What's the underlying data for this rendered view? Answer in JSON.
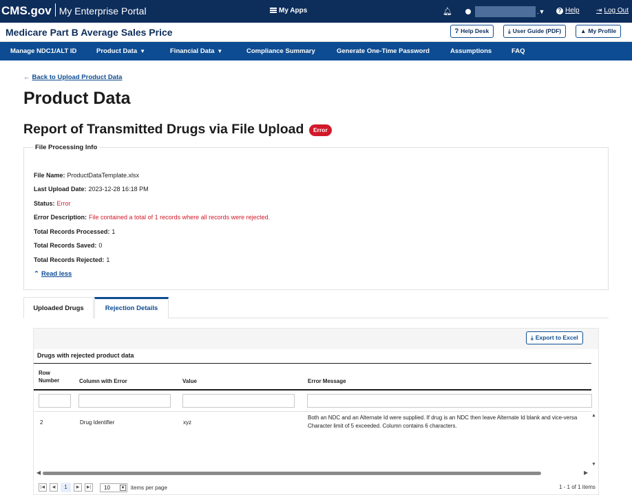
{
  "topbar": {
    "brand": "CMS.gov",
    "portal": "My Enterprise Portal",
    "my_apps": "My Apps",
    "help": "Help",
    "logout": "Log Out"
  },
  "header": {
    "app_title": "Medicare Part B Average Sales Price",
    "help_desk": "Help Desk",
    "user_guide": "User Guide (PDF)",
    "my_profile": "My Profile"
  },
  "nav": {
    "items": [
      {
        "label": "Manage NDC1/ALT ID"
      },
      {
        "label": "Product Data"
      },
      {
        "label": "Financial Data"
      },
      {
        "label": "Compliance Summary"
      },
      {
        "label": "Generate One-Time Password"
      },
      {
        "label": "Assumptions"
      },
      {
        "label": "FAQ"
      }
    ]
  },
  "page": {
    "back_link": "Back to Upload Product Data",
    "title": "Product Data",
    "subtitle": "Report of Transmitted Drugs via File Upload",
    "status_badge": "Error"
  },
  "info": {
    "legend": "File Processing Info",
    "rows": [
      {
        "label": "File Name:",
        "value": "ProductDataTemplate.xlsx"
      },
      {
        "label": "Last Upload Date:",
        "value": "2023-12-28 16:18 PM"
      },
      {
        "label": "Status:",
        "value": "Error"
      },
      {
        "label": "Error Description:",
        "value": "File contained a total of 1 records where all records were rejected."
      },
      {
        "label": "Total Records Processed:",
        "value": "1"
      },
      {
        "label": "Total Records Saved:",
        "value": "0"
      },
      {
        "label": "Total Records Rejected:",
        "value": "1"
      }
    ],
    "read_less": "Read less"
  },
  "tabs": [
    {
      "label": "Uploaded Drugs"
    },
    {
      "label": "Rejection Details"
    }
  ],
  "grid": {
    "export_label": "Export to Excel",
    "title": "Drugs with rejected product data",
    "columns": [
      {
        "label_line1": "Row",
        "label_line2": "Number"
      },
      {
        "label": "Column with Error"
      },
      {
        "label": "Value"
      },
      {
        "label": "Error Message"
      }
    ],
    "rows": [
      {
        "row_number": "2",
        "column": "Drug Identifier",
        "value": "xyz",
        "message_line1": "Both an NDC and an Alternate Id were supplied. If drug is an NDC then leave Alternate Id blank and vice-versa",
        "message_line2": "Character limit of 5 exceeded. Column contains 6 characters."
      }
    ],
    "pager": {
      "current_page": "1",
      "page_size": "10",
      "items_per_page": "items per page",
      "info": "1 - 1 of 1 items"
    }
  },
  "colors": {
    "topbar": "#0d2d5b",
    "nav": "#0d4c92",
    "error": "#d11a2a"
  }
}
